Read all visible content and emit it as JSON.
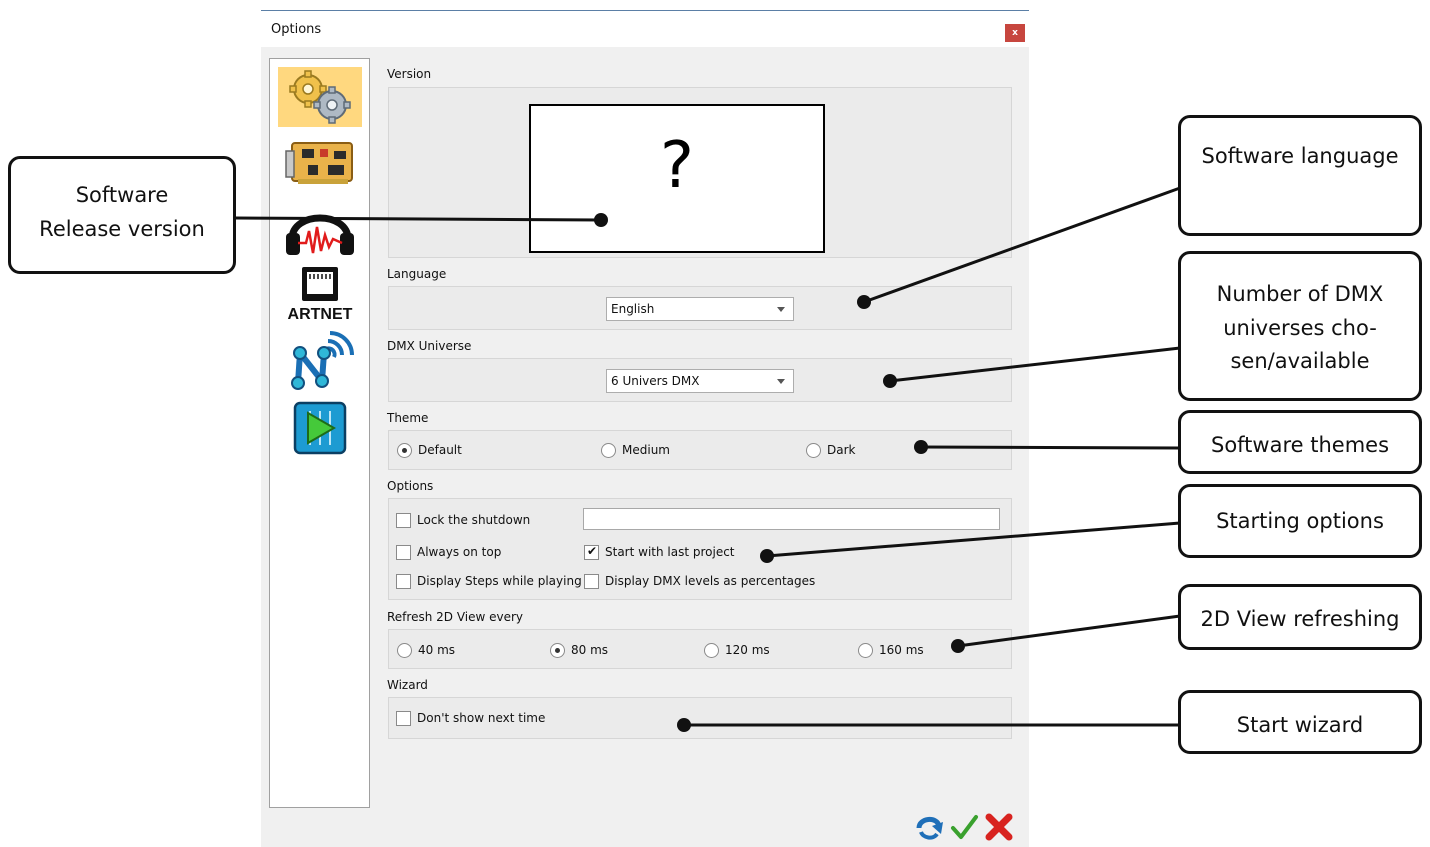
{
  "window": {
    "title": "Options",
    "close_label": "x"
  },
  "sidebar": {
    "artnet_label": "ARTNET"
  },
  "version": {
    "label": "Version",
    "placeholder": "?"
  },
  "language": {
    "label": "Language",
    "selected": "English"
  },
  "dmx": {
    "label": "DMX Universe",
    "selected": "6 Univers DMX"
  },
  "theme": {
    "label": "Theme",
    "options": [
      "Default",
      "Medium",
      "Dark"
    ],
    "selected": "Default"
  },
  "options": {
    "label": "Options",
    "lock_shutdown": "Lock the shutdown",
    "always_on_top": "Always on top",
    "start_last_project": "Start with last project",
    "display_steps": "Display Steps while playing",
    "display_dmx_percent": "Display DMX levels as percentages",
    "checked": {
      "lock_shutdown": false,
      "always_on_top": false,
      "start_last_project": true,
      "display_steps": false,
      "display_dmx_percent": false
    },
    "lock_password_value": ""
  },
  "refresh": {
    "label": "Refresh 2D View every",
    "options": [
      "40 ms",
      "80 ms",
      "120 ms",
      "160 ms"
    ],
    "selected": "80 ms"
  },
  "wizard": {
    "label": "Wizard",
    "dont_show": "Don't show next time",
    "checked": false
  },
  "check_glyph": "✔",
  "callouts": {
    "release_line1": "Software",
    "release_line2": "Release version",
    "language": "Software language",
    "dmx_line1": "Number of DMX",
    "dmx_line2": "universes cho-",
    "dmx_line3": "sen/available",
    "themes": "Software themes",
    "starting": "Starting options",
    "refresh": "2D View refreshing",
    "wizard": "Start wizard"
  },
  "colors": {
    "selected_item": "#ffd87f",
    "close": "#c7463e",
    "confirm": "#3aa12e",
    "cancel": "#d8231f",
    "reset": "#1f6fb8"
  }
}
